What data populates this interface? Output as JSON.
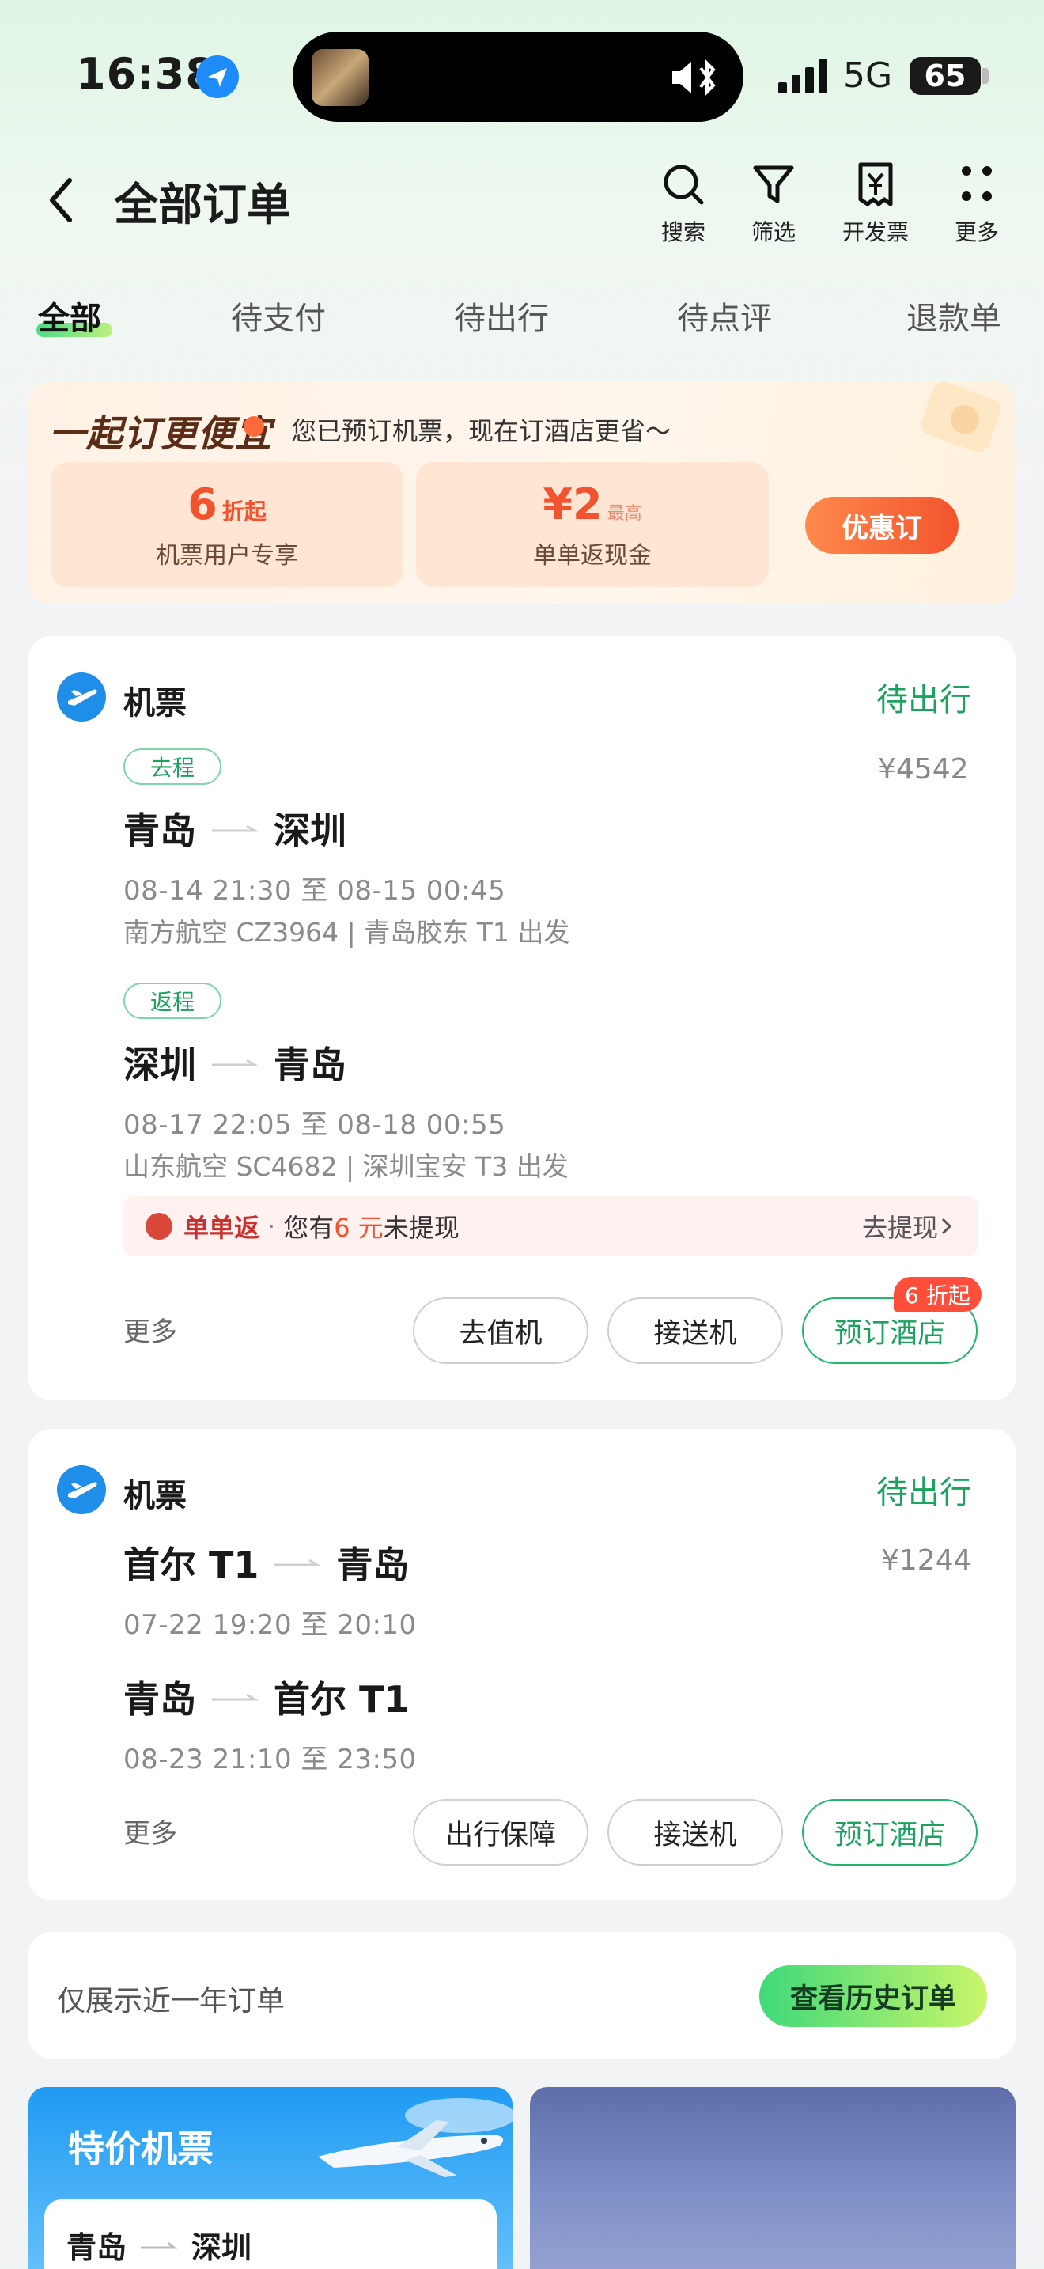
{
  "status_bar": {
    "time": "16:38",
    "network": "5G",
    "battery": "65"
  },
  "header": {
    "title": "全部订单",
    "tools": [
      {
        "label": "搜索",
        "icon": "search-icon"
      },
      {
        "label": "筛选",
        "icon": "filter-icon"
      },
      {
        "label": "开发票",
        "icon": "invoice-icon"
      },
      {
        "label": "更多",
        "icon": "more-dots-icon"
      }
    ]
  },
  "tabs": [
    {
      "label": "全部",
      "active": true
    },
    {
      "label": "待支付",
      "active": false
    },
    {
      "label": "待出行",
      "active": false
    },
    {
      "label": "待点评",
      "active": false
    },
    {
      "label": "退款单",
      "active": false
    }
  ],
  "promo": {
    "brand": "一起订更便宜",
    "subtitle": "您已预订机票，现在订酒店更省～",
    "coupons": [
      {
        "value": "6",
        "unit": "折起",
        "extra": "",
        "desc": "机票用户专享"
      },
      {
        "value": "¥2",
        "unit": "",
        "extra": "最高",
        "desc": "单单返现金"
      }
    ],
    "button": "优惠订"
  },
  "orders": [
    {
      "type": "机票",
      "status": "待出行",
      "price": "¥4542",
      "legs": [
        {
          "badge": "去程",
          "from": "青岛",
          "to": "深圳",
          "time": "08-14 21:30 至 08-15 00:45",
          "flight": "南方航空 CZ3964 | 青岛胶东 T1 出发"
        },
        {
          "badge": "返程",
          "from": "深圳",
          "to": "青岛",
          "time": "08-17 22:05 至 08-18 00:55",
          "flight": "山东航空 SC4682 | 深圳宝安 T3 出发"
        }
      ],
      "cashback": {
        "title": "单单返",
        "dot": "·",
        "pre": "您有",
        "amount": "6 元",
        "post": "未提现",
        "link": "去提现"
      },
      "more": "更多",
      "actions": [
        "去值机",
        "接送机",
        "预订酒店"
      ],
      "hotel_badge": "6 折起"
    },
    {
      "type": "机票",
      "status": "待出行",
      "price": "¥1244",
      "legs": [
        {
          "from": "首尔 T1",
          "to": "青岛",
          "time": "07-22 19:20 至 20:10"
        },
        {
          "from": "青岛",
          "to": "首尔 T1",
          "time": "08-23 21:10 至 23:50"
        }
      ],
      "more": "更多",
      "actions": [
        "出行保障",
        "接送机",
        "预订酒店"
      ]
    }
  ],
  "history": {
    "text": "仅展示近一年订单",
    "button": "查看历史订单"
  },
  "feed": {
    "title": "特价机票",
    "from": "青岛",
    "to": "深圳"
  },
  "colors": {
    "accent_green": "#19a35c",
    "promo_orange": "#f2522e",
    "plane_blue": "#1e8ee8"
  }
}
